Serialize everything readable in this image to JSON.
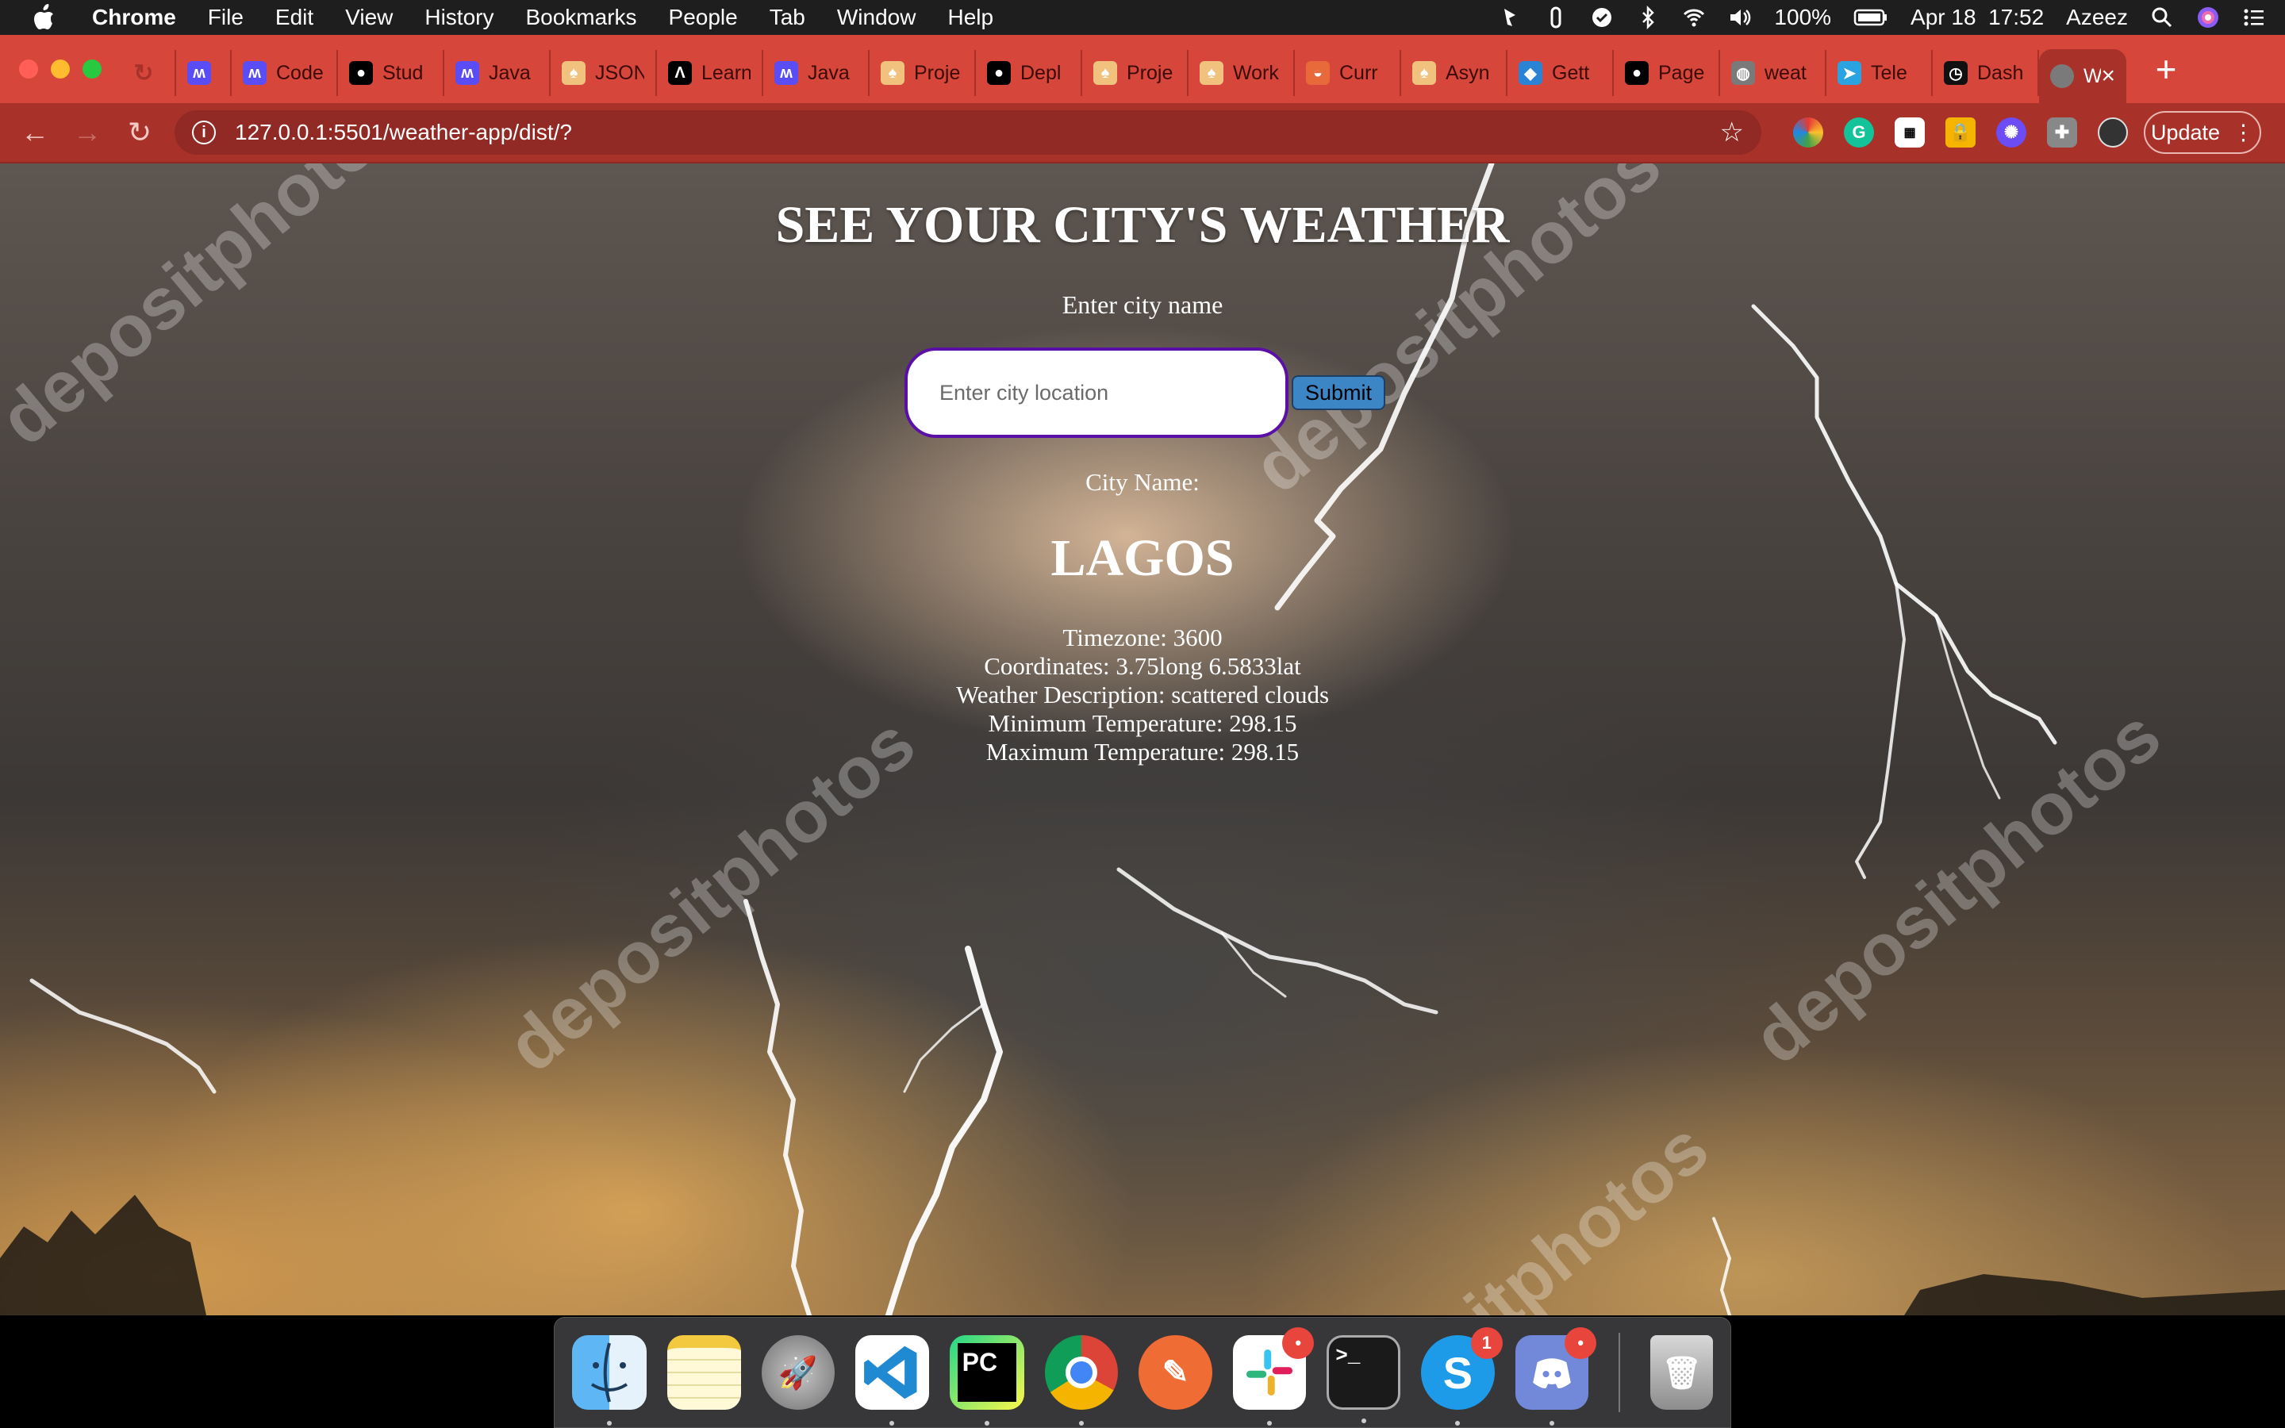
{
  "menubar": {
    "app_name": "Chrome",
    "menus": [
      "File",
      "Edit",
      "View",
      "History",
      "Bookmarks",
      "People",
      "Tab",
      "Window",
      "Help"
    ],
    "battery": "100%",
    "datetime": "Apr 18  17:52",
    "user": "Azeez"
  },
  "tabs": [
    {
      "title": "",
      "icon": "loading-icon"
    },
    {
      "title": "",
      "icon": "m-logo-icon"
    },
    {
      "title": "Code",
      "icon": "m-logo-icon"
    },
    {
      "title": "Stud",
      "icon": "github-icon"
    },
    {
      "title": "Java",
      "icon": "m-logo-icon"
    },
    {
      "title": "JSON",
      "icon": "owl-icon"
    },
    {
      "title": "Learn",
      "icon": "code-icon"
    },
    {
      "title": "Java",
      "icon": "m-logo-icon"
    },
    {
      "title": "Proje",
      "icon": "owl-icon"
    },
    {
      "title": "Depl",
      "icon": "github-icon"
    },
    {
      "title": "Proje",
      "icon": "owl-icon"
    },
    {
      "title": "Work",
      "icon": "owl-icon"
    },
    {
      "title": "Curr",
      "icon": "hat-icon"
    },
    {
      "title": "Asyn",
      "icon": "owl-icon"
    },
    {
      "title": "Gett",
      "icon": "cube-icon"
    },
    {
      "title": "Page",
      "icon": "github-icon"
    },
    {
      "title": "weat",
      "icon": "globe-icon"
    },
    {
      "title": "Tele",
      "icon": "telegram-icon"
    },
    {
      "title": "Dash",
      "icon": "clock-icon"
    }
  ],
  "active_tab": {
    "title": "W",
    "close": "×"
  },
  "new_tab": "+",
  "toolbar": {
    "url": "127.0.0.1:5501/weather-app/dist/?",
    "update_label": "Update"
  },
  "page": {
    "title": "SEE YOUR CITY'S WEATHER",
    "enter_label": "Enter city name",
    "input_placeholder": "Enter city location",
    "submit_label": "Submit",
    "city_label": "City Name:",
    "city_name": "LAGOS",
    "timezone": "Timezone: 3600",
    "coordinates": "Coordinates: 3.75long 6.5833lat",
    "description": "Weather Description: scattered clouds",
    "min_temp": "Minimum Temperature: 298.15",
    "max_temp": "Maximum Temperature: 298.15"
  },
  "watermark": "depositphotos",
  "dock": {
    "apps": [
      "Finder",
      "Notes",
      "Launchpad",
      "Visual Studio Code",
      "PyCharm",
      "Chrome",
      "Postman",
      "Slack",
      "Terminal",
      "Skype",
      "Discord",
      "Trash"
    ],
    "skype_badge": "1",
    "slack_badge": "•",
    "discord_badge": "•",
    "pycharm_label": "PC",
    "terminal_label": ">_"
  }
}
